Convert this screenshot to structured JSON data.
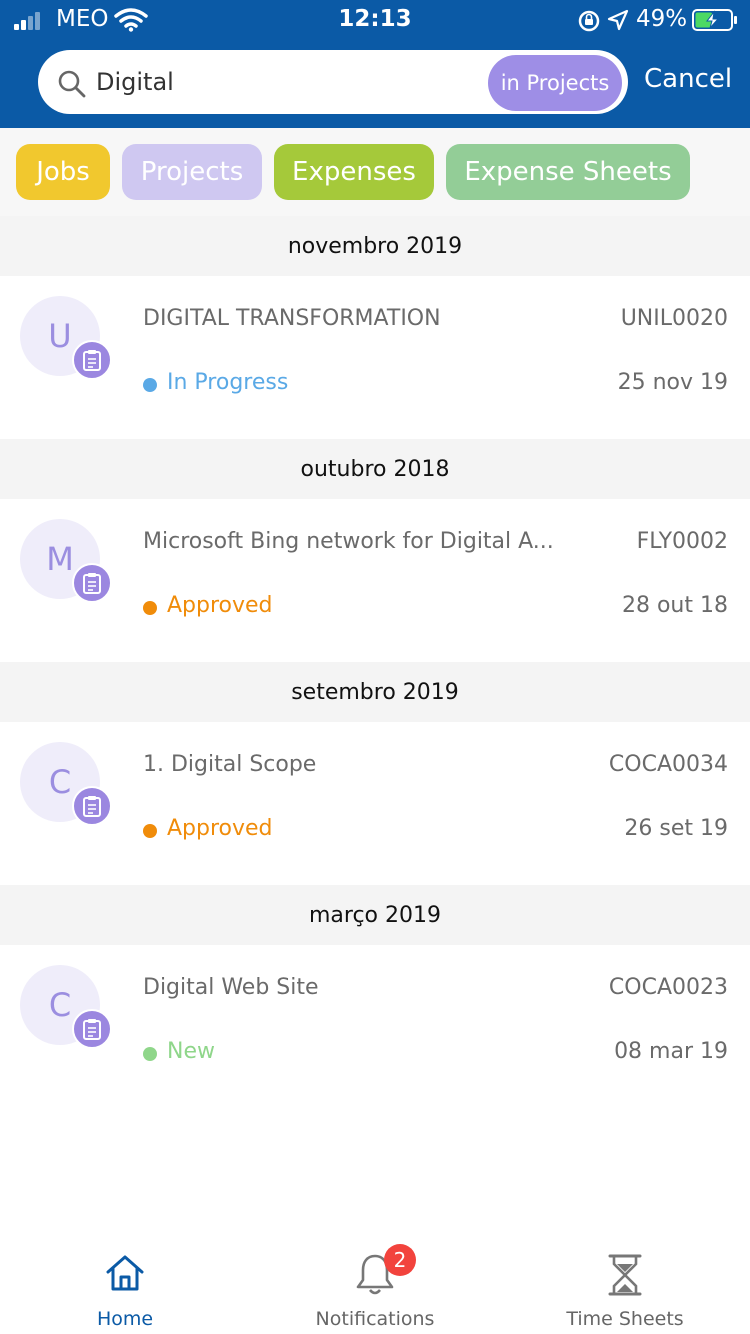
{
  "status_bar": {
    "carrier": "MEO",
    "time": "12:13",
    "battery_percent": "49%",
    "battery_level": 0.49
  },
  "search": {
    "value": "Digital",
    "scope": "in Projects",
    "cancel_label": "Cancel"
  },
  "filters": [
    {
      "label": "Jobs",
      "color": "#f1c82e"
    },
    {
      "label": "Projects",
      "color": "#cfc8f1"
    },
    {
      "label": "Expenses",
      "color": "#a5c93a"
    },
    {
      "label": "Expense Sheets",
      "color": "#93cd97"
    }
  ],
  "groups": [
    {
      "header": "novembro 2019",
      "item": {
        "initial": "U",
        "title": "DIGITAL TRANSFORMATION",
        "code": "UNIL0020",
        "status": "In Progress",
        "status_color": "#5aa9e6",
        "date": "25 nov 19"
      }
    },
    {
      "header": "outubro 2018",
      "item": {
        "initial": "M",
        "title": "Microsoft Bing network for Digital A...",
        "code": "FLY0002",
        "status": "Approved",
        "status_color": "#f08c0a",
        "date": "28 out 18"
      }
    },
    {
      "header": "setembro 2019",
      "item": {
        "initial": "C",
        "title": "1. Digital Scope",
        "code": "COCA0034",
        "status": "Approved",
        "status_color": "#f08c0a",
        "date": "26 set 19"
      }
    },
    {
      "header": "março 2019",
      "item": {
        "initial": "C",
        "title": "Digital Web Site",
        "code": "COCA0023",
        "status": "New",
        "status_color": "#8fd68a",
        "date": "08 mar 19"
      }
    }
  ],
  "tabbar": {
    "home": "Home",
    "notifications": "Notifications",
    "notifications_badge": "2",
    "timesheets": "Time Sheets"
  },
  "colors": {
    "header_bg": "#0b5aa6",
    "accent": "#0b5aa6"
  }
}
